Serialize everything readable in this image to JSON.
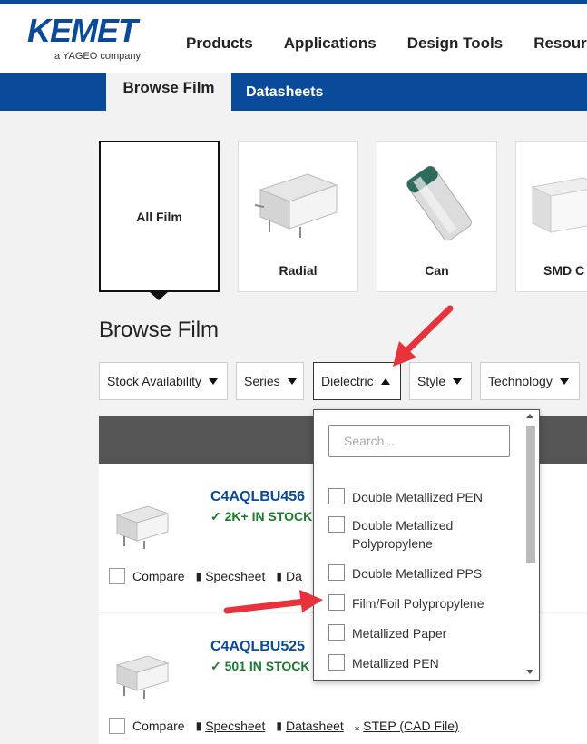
{
  "brand": {
    "name": "KEMET",
    "tagline": "a YAGEO company",
    "color": "#0a4a9a"
  },
  "nav": [
    "Products",
    "Applications",
    "Design Tools",
    "Resources"
  ],
  "subnav": {
    "active": "Browse Film",
    "other": "Datasheets"
  },
  "categories": [
    {
      "label": "All Film",
      "active": true
    },
    {
      "label": "Radial",
      "icon": "radial-capacitor-icon"
    },
    {
      "label": "Can",
      "icon": "can-capacitor-icon"
    },
    {
      "label": "SMD C",
      "icon": "smd-capacitor-icon"
    }
  ],
  "heading": "Browse Film",
  "filters": [
    {
      "label": "Stock Availability"
    },
    {
      "label": "Series"
    },
    {
      "label": "Dielectric",
      "open": true
    },
    {
      "label": "Style"
    },
    {
      "label": "Technology"
    }
  ],
  "dropdown": {
    "search_placeholder": "Search...",
    "options": [
      "Double Metallized PEN",
      "Double Metallized Polypropylene",
      "Double Metallized PPS",
      "Film/Foil Polypropylene",
      "Metallized Paper",
      "Metallized PEN"
    ]
  },
  "results": [
    {
      "part": "C4AQLBU456",
      "stock": "2K+ IN STOCK",
      "compare": "Compare",
      "specsheet": "Specsheet",
      "datasheet": "Da"
    },
    {
      "part": "C4AQLBU525",
      "stock": "501 IN STOCK",
      "compare": "Compare",
      "specsheet": "Specsheet",
      "datasheet": "Datasheet",
      "step": "STEP (CAD File)"
    }
  ],
  "colors": {
    "accent": "#0a4a9a",
    "stock": "#1c7a2e",
    "arrow": "#e8323c"
  }
}
